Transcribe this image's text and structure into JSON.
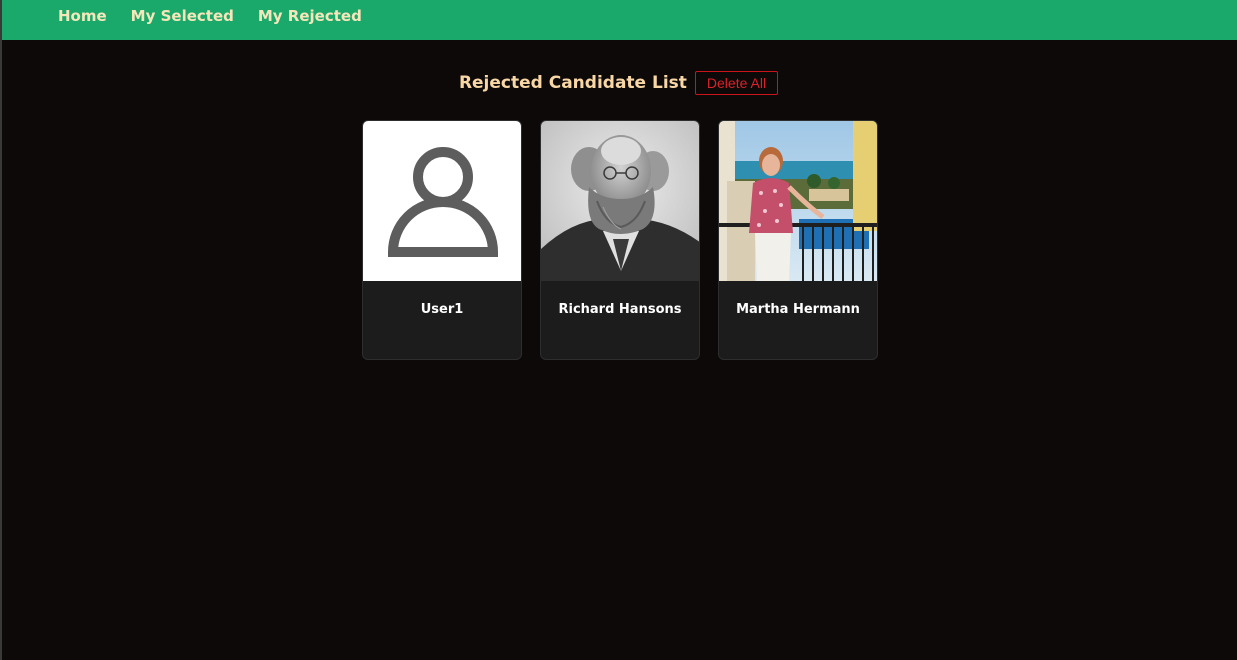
{
  "nav": {
    "items": [
      {
        "label": "Home"
      },
      {
        "label": "My Selected"
      },
      {
        "label": "My Rejected"
      }
    ]
  },
  "main": {
    "heading": "Rejected Candidate List",
    "delete_all_label": "Delete All"
  },
  "candidates": [
    {
      "name": "User1",
      "avatar": "default-user-icon"
    },
    {
      "name": "Richard Hansons",
      "avatar": "photo"
    },
    {
      "name": "Martha Hermann",
      "avatar": "photo"
    }
  ],
  "colors": {
    "navbar": "#1aa96b",
    "nav_text": "#f6e7bb",
    "page_bg": "#0d0909",
    "heading": "#f8d7a5",
    "danger": "#d9232a",
    "card_bg": "#1c1c1c"
  }
}
